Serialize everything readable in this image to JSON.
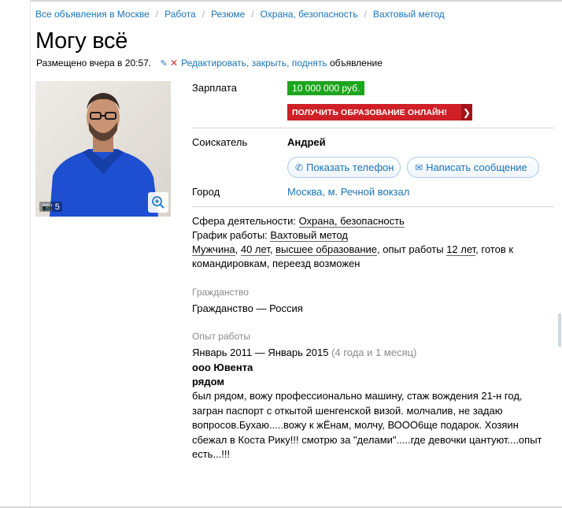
{
  "breadcrumb": [
    "Все объявления в Москве",
    "Работа",
    "Резюме",
    "Охрана, безопасность",
    "Вахтовый метод"
  ],
  "title": "Могу всё",
  "posted": {
    "text": "Размещено вчера в 20:57.",
    "actions_link": "Редактировать, закрыть, поднять",
    "actions_suffix": "объявление"
  },
  "photo": {
    "count": "5"
  },
  "salary": {
    "label": "Зарплата",
    "value": "10 000 000 руб."
  },
  "promo": {
    "text": "ПОЛУЧИТЬ ОБРАЗОВАНИЕ ОНЛАЙН!",
    "color": "#cf2027"
  },
  "applicant": {
    "label": "Соискатель",
    "name": "Андрей",
    "show_phone": "Показать телефон",
    "send_message": "Написать сообщение"
  },
  "city": {
    "label": "Город",
    "value": "Москва, м. Речной вокзал"
  },
  "details": {
    "sphere_label": "Сфера деятельности:",
    "sphere_value": "Охрана, безопасность",
    "schedule_label": "График работы:",
    "schedule_value": "Вахтовый метод",
    "gender": "Мужчина",
    "age": "40 лет",
    "education": "высшее образование",
    "experience_prefix": "опыт работы",
    "experience_value": "12 лет",
    "travel": "готов к командировкам",
    "relocation": "переезд возможен"
  },
  "citizenship": {
    "label": "Гражданство",
    "value": "Гражданство — Россия"
  },
  "work_experience": {
    "label": "Опыт работы",
    "period": "Январь 2011 — Январь 2015",
    "duration": "(4 года и 1 месяц)",
    "company": "ооо Ювента",
    "position": "рядом",
    "description": "был рядом, вожу профессионально машину, стаж вождения 21-н год, загран паспорт с откытой шенгенской визой. молчалив, не задаю вопросов.Бухаю.....вожу к жЁнам, молчу, ВООО6ще подарок. Хозяин сбежал в Коста Рику!!! смотрю за \"делами\".....где девочки цантуют....опыт есть...!!!"
  },
  "colors": {
    "link": "#1a74b8",
    "salary_badge": "#1ea51e"
  }
}
